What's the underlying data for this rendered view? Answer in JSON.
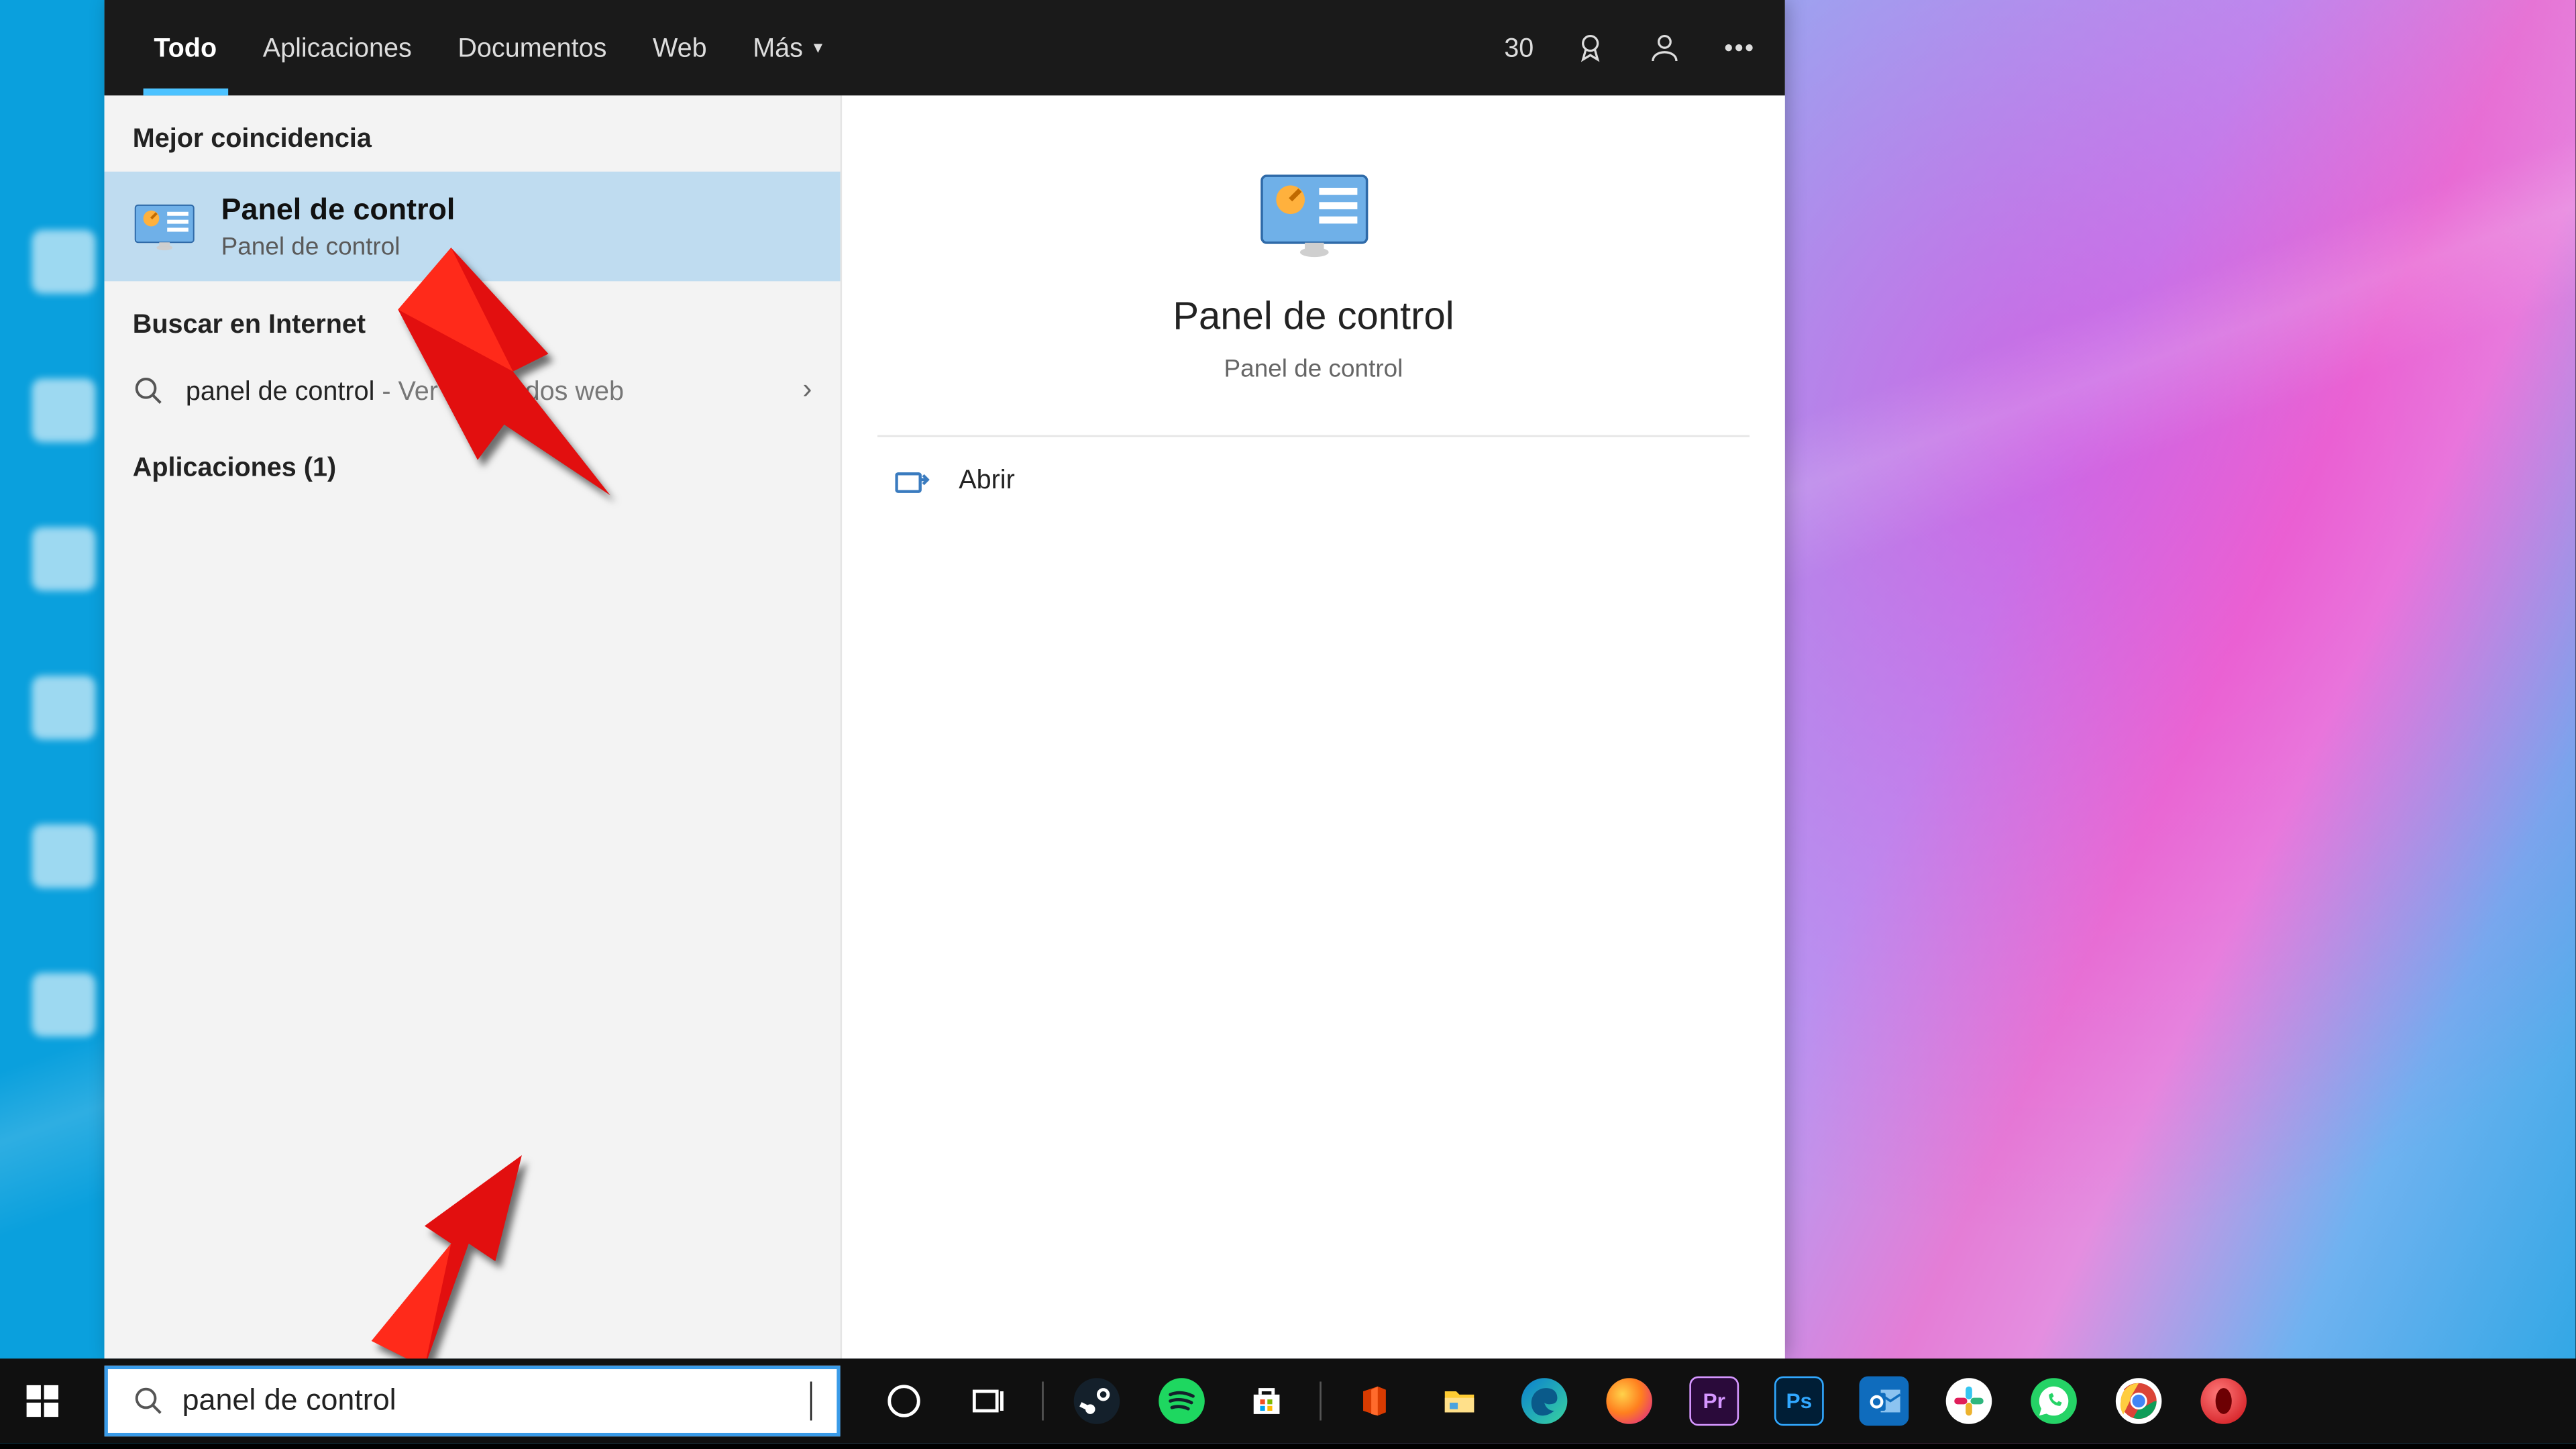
{
  "header": {
    "tabs": {
      "all": "Todo",
      "apps": "Aplicaciones",
      "docs": "Documentos",
      "web": "Web",
      "more": "Más"
    },
    "points": "30"
  },
  "left": {
    "best_match_label": "Mejor coincidencia",
    "best_match": {
      "title": "Panel de control",
      "subtitle": "Panel de control"
    },
    "search_internet_label": "Buscar en Internet",
    "web_result": {
      "query": "panel de control",
      "suffix": " - Ver resultados web"
    },
    "apps_label": "Aplicaciones (1)"
  },
  "detail": {
    "title": "Panel de control",
    "subtitle": "Panel de control",
    "open": "Abrir"
  },
  "searchbox": {
    "value": "panel de control"
  },
  "taskbar": {
    "apps": [
      "cortana",
      "task-view",
      "sep",
      "steam",
      "spotify",
      "microsoft-store",
      "sep",
      "office",
      "file-explorer",
      "edge",
      "firefox",
      "premiere",
      "photoshop",
      "outlook",
      "slack",
      "whatsapp",
      "chrome",
      "opera"
    ]
  }
}
